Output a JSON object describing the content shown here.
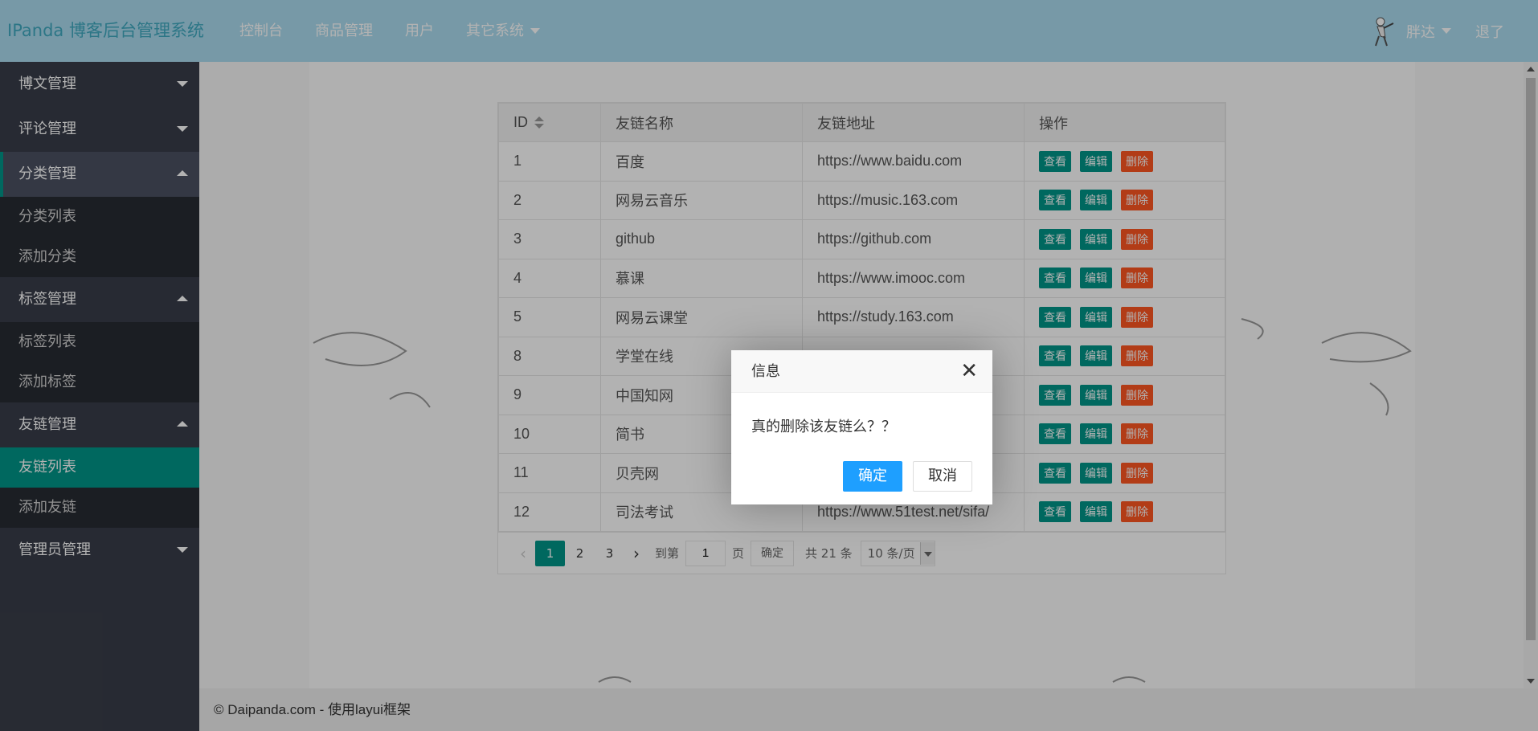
{
  "header": {
    "logo": "IPanda 博客后台管理系统",
    "nav": [
      {
        "label": "控制台"
      },
      {
        "label": "商品管理"
      },
      {
        "label": "用户"
      },
      {
        "label": "其它系统"
      }
    ],
    "user_name": "胖达",
    "logout": "退了"
  },
  "sidebar": {
    "blog": "博文管理",
    "comment": "评论管理",
    "category": "分类管理",
    "category_list": "分类列表",
    "category_add": "添加分类",
    "tag": "标签管理",
    "tag_list": "标签列表",
    "tag_add": "添加标签",
    "link": "友链管理",
    "link_list": "友链列表",
    "link_add": "添加友链",
    "admin": "管理员管理"
  },
  "table": {
    "columns": [
      "ID",
      "友链名称",
      "友链地址",
      "操作"
    ],
    "rows": [
      {
        "id": "1",
        "name": "百度",
        "url": "https://www.baidu.com"
      },
      {
        "id": "2",
        "name": "网易云音乐",
        "url": "https://music.163.com"
      },
      {
        "id": "3",
        "name": "github",
        "url": "https://github.com"
      },
      {
        "id": "4",
        "name": "慕课",
        "url": "https://www.imooc.com"
      },
      {
        "id": "5",
        "name": "网易云课堂",
        "url": "https://study.163.com"
      },
      {
        "id": "8",
        "name": "学堂在线",
        "url": ""
      },
      {
        "id": "9",
        "name": "中国知网",
        "url": ""
      },
      {
        "id": "10",
        "name": "简书",
        "url": ""
      },
      {
        "id": "11",
        "name": "贝壳网",
        "url": ""
      },
      {
        "id": "12",
        "name": "司法考试",
        "url": "https://www.51test.net/sifa/"
      }
    ],
    "actions": {
      "view": "查看",
      "edit": "编辑",
      "delete": "删除"
    }
  },
  "pager": {
    "pages": [
      "1",
      "2",
      "3"
    ],
    "current": "1",
    "goto_label": "到第",
    "goto_value": "1",
    "page_label": "页",
    "confirm": "确定",
    "total": "共 21 条",
    "per_page": "10 条/页"
  },
  "dialog": {
    "title": "信息",
    "message": "真的删除该友链么？？",
    "ok": "确定",
    "cancel": "取消"
  },
  "footer": "© Daipanda.com - 使用layui框架"
}
